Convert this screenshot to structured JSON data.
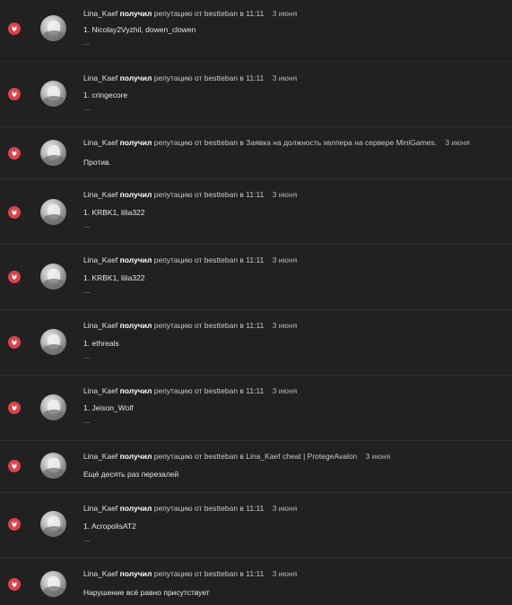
{
  "colors": {
    "background": "#212121",
    "separator": "#2f2f2f",
    "reputation_negative": "#d9434d"
  },
  "icons": {
    "reputation": "reputation-down-icon",
    "avatar": "user-avatar"
  },
  "entries": [
    {
      "user": "Lina_Kaef",
      "verb": "получил",
      "text": "репутацию от bestteban в 11:11",
      "date": "3 июня",
      "content": "1. Nicolay2Vyzhil, dowen_clowen",
      "more": "..."
    },
    {
      "user": "Lina_Kaef",
      "verb": "получил",
      "text": "репутацию от bestteban в 11:11",
      "date": "3 июня",
      "content": "1. cringecore",
      "more": "..."
    },
    {
      "user": "Lina_Kaef",
      "verb": "получил",
      "text": "репутацию от bestteban в Заявка на должность хелпера на сервере MiniGames.",
      "date": "3 июня",
      "content": "Против.",
      "more": ""
    },
    {
      "user": "Lina_Kaef",
      "verb": "получил",
      "text": "репутацию от bestteban в 11:11",
      "date": "3 июня",
      "content": "1. KRBK1, lilia322",
      "more": "..."
    },
    {
      "user": "Lina_Kaef",
      "verb": "получил",
      "text": "репутацию от bestteban в 11:11",
      "date": "3 июня",
      "content": "1. KRBK1, lilia322",
      "more": "..."
    },
    {
      "user": "Lina_Kaef",
      "verb": "получил",
      "text": "репутацию от bestteban в 11:11",
      "date": "3 июня",
      "content": "1. ethreals",
      "more": "..."
    },
    {
      "user": "Lina_Kaef",
      "verb": "получил",
      "text": "репутацию от bestteban в 11:11",
      "date": "3 июня",
      "content": "1. Jeison_Wolf",
      "more": "..."
    },
    {
      "user": "Lina_Kaef",
      "verb": "получил",
      "text": "репутацию от bestteban в Lina_Kaef cheat | ProtegeAvalon",
      "date": "3 июня",
      "content": "Ещё десять раз перезалей",
      "more": ""
    },
    {
      "user": "Lina_Kaef",
      "verb": "получил",
      "text": "репутацию от bestteban в 11:11",
      "date": "3 июня",
      "content": "1. AcropolisAT2",
      "more": "..."
    },
    {
      "user": "Lina_Kaef",
      "verb": "получил",
      "text": "репутацию от bestteban в 11:11",
      "date": "3 июня",
      "content": "Нарушение всё равно присутствует",
      "more": ""
    }
  ]
}
